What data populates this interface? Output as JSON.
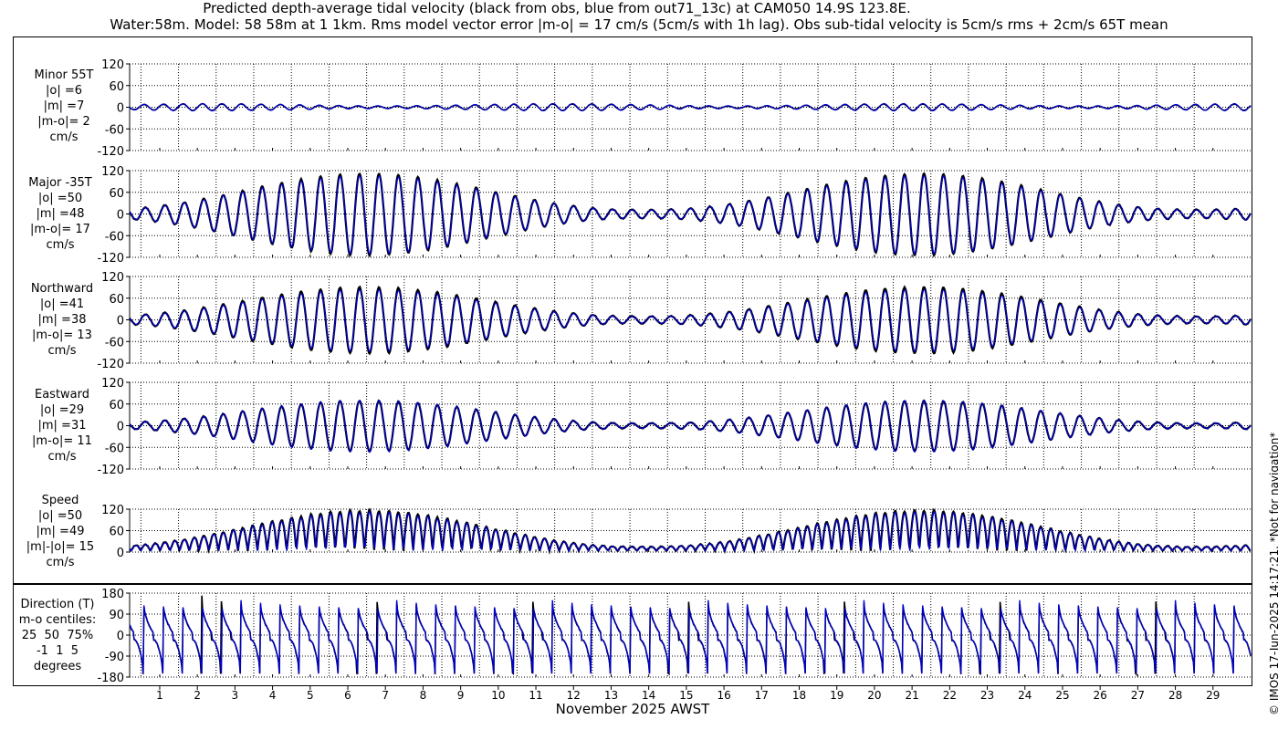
{
  "titles": {
    "line1": "Predicted depth-average tidal velocity (black from obs, blue from out71_13c) at CAM050 14.9S 123.8E.",
    "line2": "Water:58m. Model: 58 58m at 1 1km. Rms model vector error |m-o| = 17 cm/s (5cm/s with 1h lag). Obs sub-tidal velocity is 5cm/s rms + 2cm/s 65T mean"
  },
  "footnote": "© IMOS 17-Jun-2025 14:17:21. *Not for navigation*",
  "colors": {
    "obs": "#000000",
    "model": "#0000cc",
    "grid": "#000000"
  },
  "panels": [
    {
      "id": "minor",
      "label_lines": [
        "Minor 55T",
        "|o| =6",
        "|m| =7",
        "|m-o|= 2",
        "cm/s"
      ]
    },
    {
      "id": "major",
      "label_lines": [
        "Major -35T",
        "|o| =50",
        "|m| =48",
        "|m-o|= 17",
        "cm/s"
      ]
    },
    {
      "id": "north",
      "label_lines": [
        "Northward",
        "|o| =41",
        "|m| =38",
        "|m-o|= 13",
        "cm/s"
      ]
    },
    {
      "id": "east",
      "label_lines": [
        "Eastward",
        "|o| =29",
        "|m| =31",
        "|m-o|= 11",
        "cm/s"
      ]
    },
    {
      "id": "speed",
      "label_lines": [
        "Speed",
        "|o| =50",
        "|m| =49",
        "|m|-|o|= 15",
        "cm/s"
      ]
    },
    {
      "id": "direction",
      "label_lines": [
        "Direction (T)",
        "m-o centiles:",
        "25  50  75%",
        "-1  1  5",
        "degrees"
      ]
    }
  ],
  "chart_data": {
    "type": "line",
    "xlabel": "November 2025 AWST",
    "x_tick_labels": [
      "1",
      "2",
      "3",
      "4",
      "5",
      "6",
      "7",
      "8",
      "9",
      "10",
      "11",
      "12",
      "13",
      "14",
      "15",
      "16",
      "17",
      "18",
      "19",
      "20",
      "21",
      "22",
      "23",
      "24",
      "25",
      "26",
      "27",
      "28",
      "29"
    ],
    "xlim_days": [
      0.2,
      30.0
    ],
    "series_names": [
      "obs",
      "model"
    ],
    "subplots": [
      {
        "id": "minor",
        "ylabel": "Minor 55T",
        "yticks": [
          "-120",
          "-60",
          "0",
          "60",
          "120"
        ],
        "ylim": [
          -120,
          120
        ],
        "amplitude_obs_cm_s": 8,
        "amplitude_model_cm_s": 8,
        "rms_obs": 6,
        "rms_model": 7,
        "rms_diff": 2
      },
      {
        "id": "major",
        "ylabel": "Major -35T",
        "yticks": [
          "-120",
          "-60",
          "0",
          "60",
          "120"
        ],
        "ylim": [
          -120,
          120
        ],
        "amplitude_obs_cm_s": {
          "neap_min": 10,
          "spring_max": 113
        },
        "rms_obs": 50,
        "rms_model": 48,
        "rms_diff": 17
      },
      {
        "id": "north",
        "ylabel": "Northward",
        "yticks": [
          "-120",
          "-60",
          "0",
          "60",
          "120"
        ],
        "ylim": [
          -120,
          120
        ],
        "amplitude_obs_cm_s": {
          "neap_min": 8,
          "spring_max": 92
        },
        "rms_obs": 41,
        "rms_model": 38,
        "rms_diff": 13
      },
      {
        "id": "east",
        "ylabel": "Eastward",
        "yticks": [
          "-120",
          "-60",
          "0",
          "60",
          "120"
        ],
        "ylim": [
          -120,
          120
        ],
        "amplitude_obs_cm_s": {
          "neap_min": 6,
          "spring_max": 70
        },
        "rms_obs": 29,
        "rms_model": 31,
        "rms_diff": 11
      },
      {
        "id": "speed",
        "ylabel": "Speed",
        "yticks": [
          "0",
          "60",
          "120"
        ],
        "ylim": [
          0,
          120
        ],
        "peak_obs_cm_s": {
          "neap_min": 10,
          "spring_max": 113
        },
        "rms_obs": 50,
        "rms_model": 49,
        "rms_diff": 15
      },
      {
        "id": "direction",
        "ylabel": "Direction (T)",
        "yticks": [
          "-180",
          "-90",
          "0",
          "90",
          "180"
        ],
        "ylim": [
          -180,
          180
        ],
        "mo_centiles_percent": [
          25,
          50,
          75
        ],
        "mo_centiles_degrees": [
          -1,
          1,
          5
        ]
      }
    ],
    "tidal_period_hours": 12.42,
    "spring_neap_period_days": 14.77,
    "first_spring_day": 6.5,
    "grid": true
  }
}
